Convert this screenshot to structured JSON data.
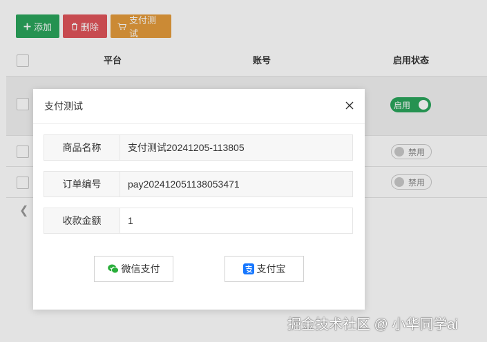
{
  "toolbar": {
    "add_label": "添加",
    "delete_label": "删除",
    "pay_test_label": "支付测试"
  },
  "table": {
    "columns": [
      "平台",
      "账号",
      "启用状态"
    ],
    "rows": [
      {
        "status_label": "启用",
        "enabled": true
      },
      {
        "status_label": "禁用",
        "enabled": false
      },
      {
        "status_label": "禁用",
        "enabled": false
      }
    ]
  },
  "modal": {
    "title": "支付测试",
    "fields": [
      {
        "label": "商品名称",
        "value": "支付测试20241205-113805"
      },
      {
        "label": "订单编号",
        "value": "pay202412051138053471"
      },
      {
        "label": "收款金额",
        "value": "1"
      }
    ],
    "wechat_label": "微信支付",
    "alipay_label": "支付宝"
  },
  "watermark": "掘金技术社区 @ 小华同学ai",
  "colors": {
    "green": "#2aa45b",
    "red": "#e0555a",
    "orange": "#e59c3c",
    "alipay_blue": "#1677ff"
  },
  "icons": {
    "add": "plus-icon",
    "delete": "trash-icon",
    "pay_test": "cart-icon",
    "close": "close-icon",
    "wechat": "wechat-pay-icon",
    "alipay": "alipay-icon"
  }
}
